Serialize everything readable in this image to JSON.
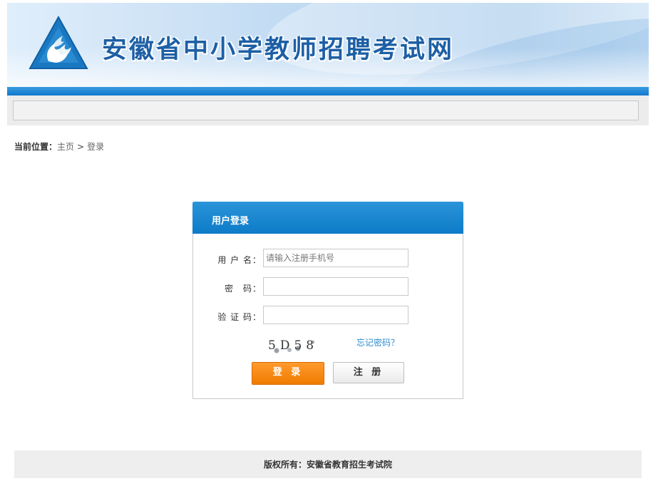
{
  "header": {
    "site_title": "安徽省中小学教师招聘考试网"
  },
  "breadcrumb": {
    "label": "当前位置：",
    "home": "主页",
    "separator": ">",
    "current": "登录"
  },
  "login": {
    "title": "用户登录",
    "username_label": "用 户 名：",
    "username_placeholder": "请输入注册手机号",
    "username_value": "",
    "password_label": "密　码：",
    "password_value": "",
    "captcha_label": "验 证 码：",
    "captcha_value": "",
    "captcha_text": "5D58",
    "forgot_password": "忘记密码？",
    "login_button": "登 录",
    "register_button": "注 册"
  },
  "footer": {
    "copyright": "版权所有：安徽省教育招生考试院"
  },
  "colors": {
    "brand_blue": "#0d7bc8",
    "title_blue": "#1d5fa5",
    "login_orange": "#f07c00",
    "link_blue": "#2a8dd0"
  },
  "icons": {
    "logo": "triangle-flame-logo-icon"
  }
}
